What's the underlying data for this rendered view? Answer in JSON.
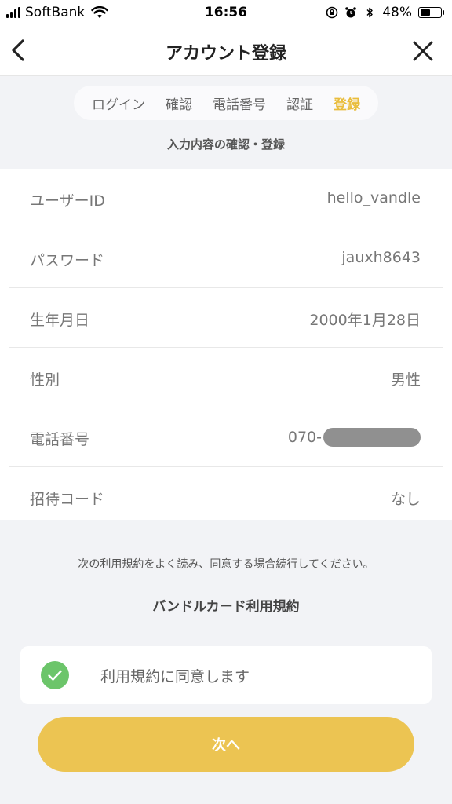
{
  "status_bar": {
    "carrier": "SoftBank",
    "time": "16:56",
    "battery_text": "48%",
    "battery_level": 0.48
  },
  "header": {
    "title": "アカウント登録",
    "back_icon": "chevron-left-icon",
    "close_icon": "close-icon"
  },
  "steps": {
    "items": [
      {
        "label": "ログイン",
        "active": false
      },
      {
        "label": "確認",
        "active": false
      },
      {
        "label": "電話番号",
        "active": false
      },
      {
        "label": "認証",
        "active": false
      },
      {
        "label": "登録",
        "active": true
      }
    ],
    "active_color": "#e9bd3c",
    "description": "入力内容の確認・登録"
  },
  "info": {
    "rows": [
      {
        "label": "ユーザーID",
        "value": "hello_vandle"
      },
      {
        "label": "パスワード",
        "value": "jauxh8643"
      },
      {
        "label": "生年月日",
        "value": "2000年1月28日"
      },
      {
        "label": "性別",
        "value": "男性"
      },
      {
        "label": "電話番号",
        "value": "070-"
      },
      {
        "label": "招待コード",
        "value": "なし"
      }
    ]
  },
  "terms": {
    "note": "次の利用規約をよく読み、同意する場合続行してください。",
    "title": "バンドルカード利用規約",
    "agree_label": "利用規約に同意します",
    "agree_checked": true,
    "check_color": "#6cc56a"
  },
  "actions": {
    "next_label": "次へ",
    "next_color": "#ecc452"
  }
}
